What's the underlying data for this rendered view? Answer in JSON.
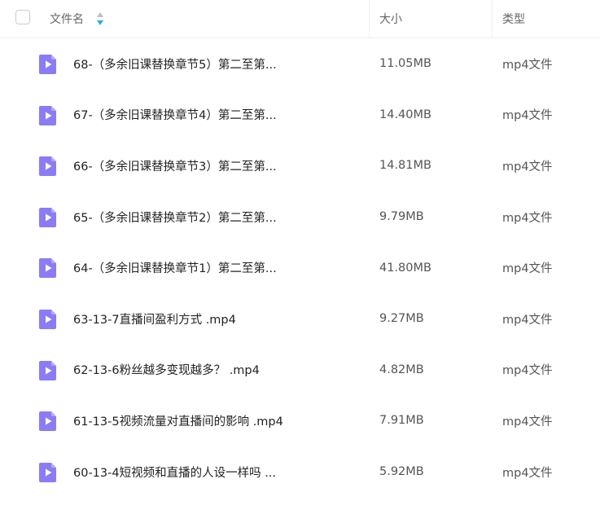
{
  "header": {
    "name_label": "文件名",
    "size_label": "大小",
    "type_label": "类型"
  },
  "colors": {
    "file_icon": "#8b7cf6",
    "sort_up": "#b8bfcc",
    "sort_down": "#2fa7f0"
  },
  "files": [
    {
      "name": "68-（多余旧课替换章节5）第二至第...",
      "size": "11.05MB",
      "type": "mp4文件",
      "icon": "video-file-icon"
    },
    {
      "name": "67-（多余旧课替换章节4）第二至第...",
      "size": "14.40MB",
      "type": "mp4文件",
      "icon": "video-file-icon"
    },
    {
      "name": "66-（多余旧课替换章节3）第二至第...",
      "size": "14.81MB",
      "type": "mp4文件",
      "icon": "video-file-icon"
    },
    {
      "name": "65-（多余旧课替换章节2）第二至第...",
      "size": "9.79MB",
      "type": "mp4文件",
      "icon": "video-file-icon"
    },
    {
      "name": "64-（多余旧课替换章节1）第二至第...",
      "size": "41.80MB",
      "type": "mp4文件",
      "icon": "video-file-icon"
    },
    {
      "name": "63-13-7直播间盈利方式 .mp4",
      "size": "9.27MB",
      "type": "mp4文件",
      "icon": "video-file-icon"
    },
    {
      "name": "62-13-6粉丝越多变现越多？ .mp4",
      "size": "4.82MB",
      "type": "mp4文件",
      "icon": "video-file-icon"
    },
    {
      "name": "61-13-5视频流量对直播间的影响 .mp4",
      "size": "7.91MB",
      "type": "mp4文件",
      "icon": "video-file-icon"
    },
    {
      "name": "60-13-4短视频和直播的人设一样吗 ...",
      "size": "5.92MB",
      "type": "mp4文件",
      "icon": "video-file-icon"
    }
  ]
}
